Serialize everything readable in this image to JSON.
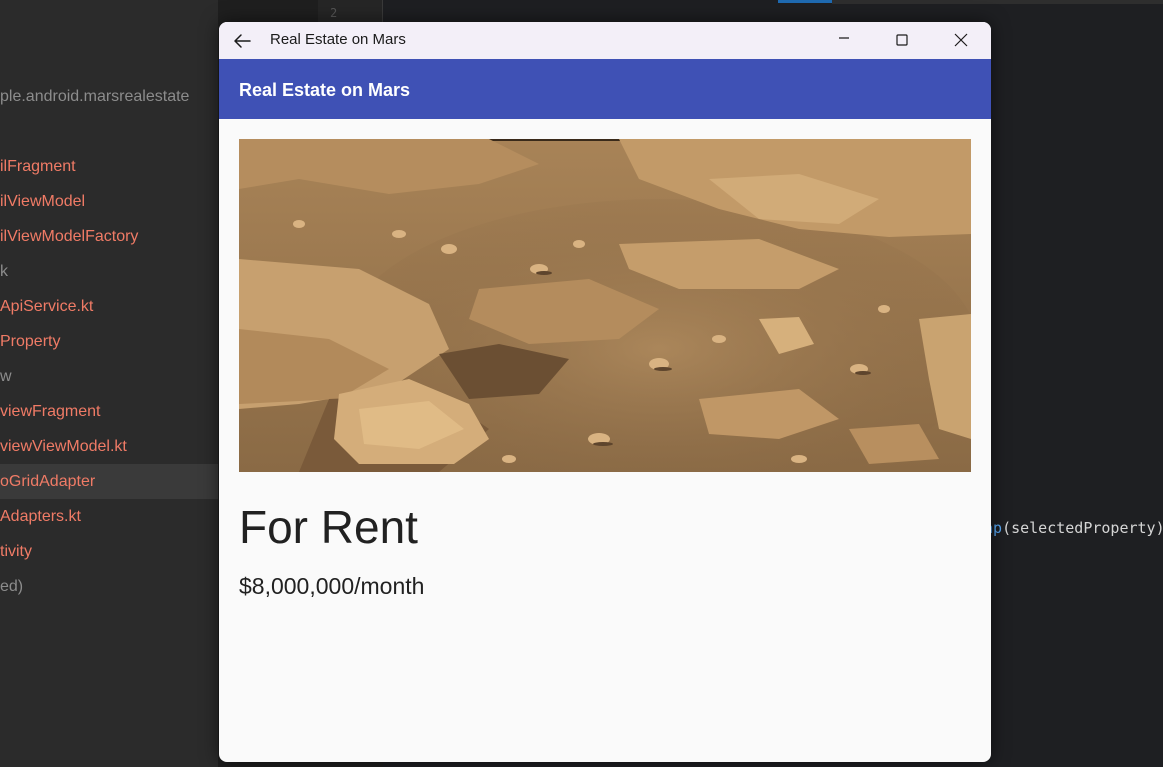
{
  "ide": {
    "tree_items": [
      {
        "label": "ple.android.marsrealestate",
        "tone": "gray"
      },
      {
        "label": "ilFragment",
        "tone": "red"
      },
      {
        "label": "ilViewModel",
        "tone": "red"
      },
      {
        "label": "ilViewModelFactory",
        "tone": "red"
      },
      {
        "label": "k",
        "tone": "gray"
      },
      {
        "label": "ApiService.kt",
        "tone": "red"
      },
      {
        "label": "Property",
        "tone": "red"
      },
      {
        "label": "w",
        "tone": "gray"
      },
      {
        "label": "viewFragment",
        "tone": "red"
      },
      {
        "label": "viewViewModel.kt",
        "tone": "red"
      },
      {
        "label": "oGridAdapter",
        "tone": "red",
        "selected": true
      },
      {
        "label": "Adapters.kt",
        "tone": "red"
      },
      {
        "label": "tivity",
        "tone": "red"
      },
      {
        "label": "ed)",
        "tone": "gray"
      }
    ],
    "gutter_number": "2",
    "code_fragment_fn": "ap",
    "code_fragment_rest": "(selectedProperty)"
  },
  "window": {
    "title": "Real Estate on Mars",
    "back_icon": "arrow-left-icon",
    "controls": [
      "minimize-icon",
      "maximize-icon",
      "close-icon"
    ]
  },
  "appbar": {
    "title": "Real Estate on Mars",
    "color": "#3f51b5"
  },
  "detail": {
    "image": "mars-terrain-photo",
    "type_label": "For Rent",
    "price_label": "$8,000,000/month"
  }
}
